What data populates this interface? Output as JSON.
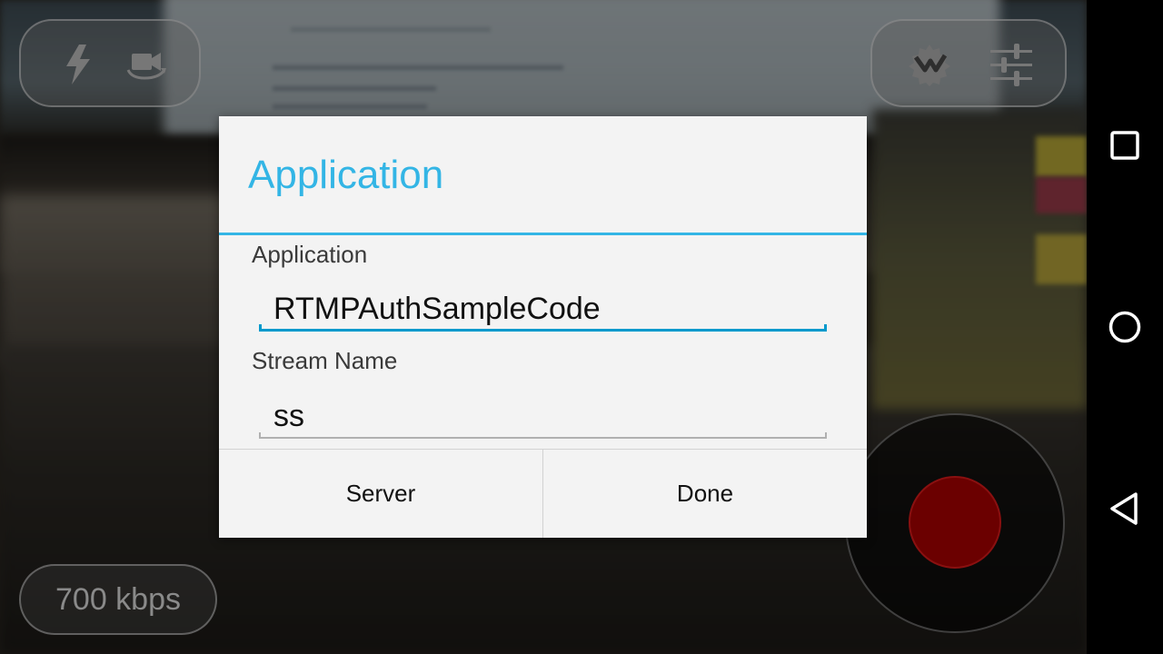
{
  "camera_controls": {
    "flash_icon": "flash-icon",
    "switch_camera_icon": "switch-camera-icon",
    "broadcast_icon": "broadcast-gear-icon",
    "settings_icon": "settings-sliders-icon"
  },
  "bitrate": {
    "label": "700 kbps"
  },
  "record": {
    "color": "#6b0000"
  },
  "dialog": {
    "title": "Application",
    "fields": [
      {
        "label": "Application",
        "value": "RTMPAuthSampleCode"
      },
      {
        "label": "Stream Name",
        "value": "ss"
      }
    ],
    "buttons": {
      "left": "Server",
      "right": "Done"
    },
    "accent_color": "#33b5e5"
  },
  "navigation": {
    "recents_icon": "square-icon",
    "home_icon": "circle-icon",
    "back_icon": "triangle-back-icon"
  }
}
